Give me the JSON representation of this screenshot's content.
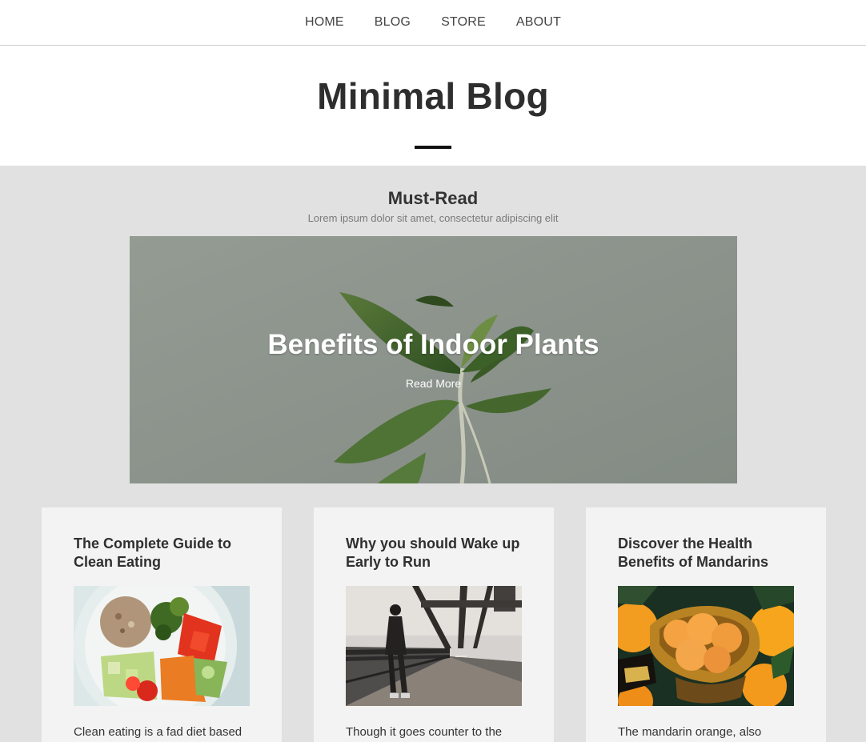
{
  "nav": {
    "items": [
      {
        "label": "HOME"
      },
      {
        "label": "BLOG"
      },
      {
        "label": "STORE"
      },
      {
        "label": "ABOUT"
      }
    ]
  },
  "header": {
    "title": "Minimal Blog"
  },
  "featured_section": {
    "title": "Must-Read",
    "subtitle": "Lorem ipsum dolor sit amet, consectetur adipiscing elit"
  },
  "hero": {
    "title": "Benefits of Indoor Plants",
    "link_label": "Read More",
    "image": "plant-photo"
  },
  "posts": [
    {
      "title": "The Complete Guide to Clean Eating",
      "excerpt": "Clean eating is a fad diet based",
      "image": "salad-bowl-photo"
    },
    {
      "title": "Why you should Wake up Early to Run",
      "excerpt": "Though it goes counter to the",
      "image": "runner-bridge-photo"
    },
    {
      "title": "Discover the Health Benefits of Mandarins",
      "excerpt": "The mandarin orange, also",
      "image": "mandarins-photo"
    }
  ],
  "colors": {
    "nav_border": "#cfcfcf",
    "main_background": "#e1e1e1",
    "card_background": "#f3f3f3",
    "hero_background": "#8b938c",
    "title_text": "#2e2e2e"
  }
}
